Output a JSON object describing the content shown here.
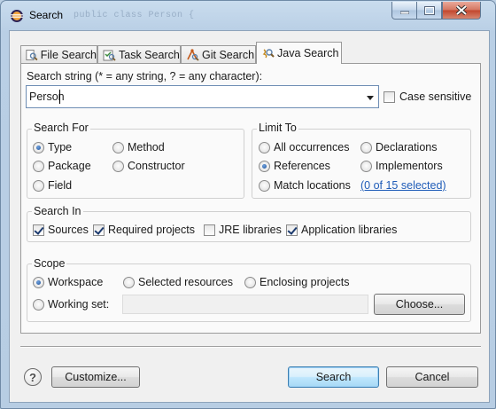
{
  "window": {
    "title": "Search",
    "background_code_text": "public class Person {"
  },
  "tabs": [
    {
      "label": "File Search",
      "icon": "file-search-icon",
      "active": false
    },
    {
      "label": "Task Search",
      "icon": "task-search-icon",
      "active": false
    },
    {
      "label": "Git Search",
      "icon": "git-search-icon",
      "active": false
    },
    {
      "label": "Java Search",
      "icon": "java-search-icon",
      "active": true
    }
  ],
  "search_string": {
    "label": "Search string (* = any string, ? = any character):",
    "value": "Person",
    "case_sensitive_label": "Case sensitive",
    "case_sensitive_checked": false
  },
  "search_for": {
    "title": "Search For",
    "options": [
      {
        "label": "Type",
        "selected": true
      },
      {
        "label": "Package",
        "selected": false
      },
      {
        "label": "Field",
        "selected": false
      },
      {
        "label": "Method",
        "selected": false
      },
      {
        "label": "Constructor",
        "selected": false
      }
    ]
  },
  "limit_to": {
    "title": "Limit To",
    "options": [
      {
        "label": "All occurrences",
        "selected": false
      },
      {
        "label": "References",
        "selected": true
      },
      {
        "label": "Match locations",
        "selected": false
      },
      {
        "label": "Declarations",
        "selected": false
      },
      {
        "label": "Implementors",
        "selected": false
      }
    ],
    "selected_link": "(0 of 15 selected)"
  },
  "search_in": {
    "title": "Search In",
    "options": [
      {
        "label": "Sources",
        "checked": true
      },
      {
        "label": "Required projects",
        "checked": true
      },
      {
        "label": "JRE libraries",
        "checked": false
      },
      {
        "label": "Application libraries",
        "checked": true
      }
    ]
  },
  "scope": {
    "title": "Scope",
    "options": [
      {
        "label": "Workspace",
        "selected": true
      },
      {
        "label": "Selected resources",
        "selected": false
      },
      {
        "label": "Enclosing projects",
        "selected": false
      },
      {
        "label": "Working set:",
        "selected": false
      }
    ],
    "working_set_value": "",
    "choose_label": "Choose..."
  },
  "footer": {
    "help_label": "?",
    "customize_label": "Customize...",
    "search_label": "Search",
    "cancel_label": "Cancel"
  }
}
